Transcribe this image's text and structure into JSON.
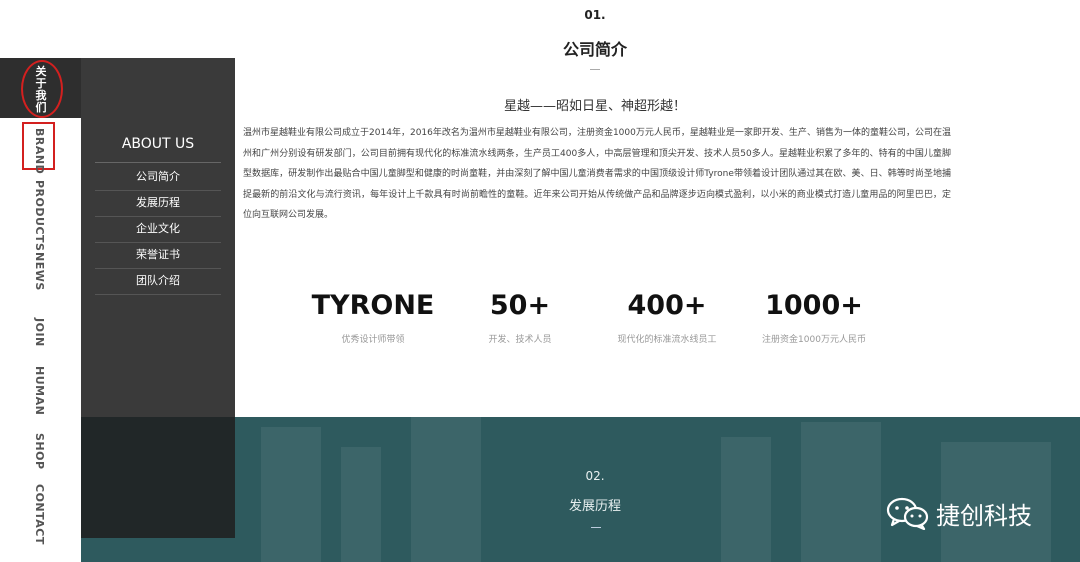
{
  "nav": {
    "active_label": "关于我们",
    "items": [
      "BRAND",
      "PRODUCTS",
      "NEWS",
      "JOIN",
      "HUMAN",
      "SHOP",
      "CONTACT"
    ],
    "annotation_color": "#d3201f"
  },
  "about": {
    "title": "ABOUT US",
    "menu": [
      "公司简介",
      "发展历程",
      "企业文化",
      "荣誉证书",
      "团队介绍"
    ]
  },
  "section1": {
    "number": "01.",
    "title": "公司简介",
    "slogan": "星越——昭如日星、神超形越！",
    "paragraph": "温州市星越鞋业有限公司成立于2014年，2016年改名为温州市星越鞋业有限公司，注册资金1000万元人民币，星越鞋业是一家即开发、生产、销售为一体的童鞋公司，公司在温州和广州分别设有研发部门，公司目前拥有现代化的标准流水线两条，生产员工400多人，中高层管理和顶尖开发、技术人员50多人。星越鞋业积累了多年的、特有的中国儿童脚型数据库，研发制作出最贴合中国儿童脚型和健康的时尚童鞋，并由深刻了解中国儿童消费者需求的中国顶级设计师Tyrone带领着设计团队通过其在欧、美、日、韩等时尚圣地捕捉最新的前沿文化与流行资讯，每年设计上千款具有时尚前瞻性的童鞋。近年来公司开始从传统做产品和品牌逐步迈向模式盈利，以小米的商业模式打造儿童用品的阿里巴巴，定位向互联网公司发展。",
    "stats": [
      {
        "value": "TYRONE",
        "label": "优秀设计师带领"
      },
      {
        "value": "50+",
        "label": "开发、技术人员"
      },
      {
        "value": "400+",
        "label": "现代化的标准流水线员工"
      },
      {
        "value": "1000+",
        "label": "注册资金1000万元人民币"
      }
    ]
  },
  "section2": {
    "number": "02.",
    "title": "发展历程"
  },
  "brand": {
    "icon": "wechat-icon",
    "name": "捷创科技"
  },
  "colors": {
    "dark_panel": "#3a3a3a",
    "banner": "#2e5a5e",
    "accent_red": "#d3201f"
  }
}
